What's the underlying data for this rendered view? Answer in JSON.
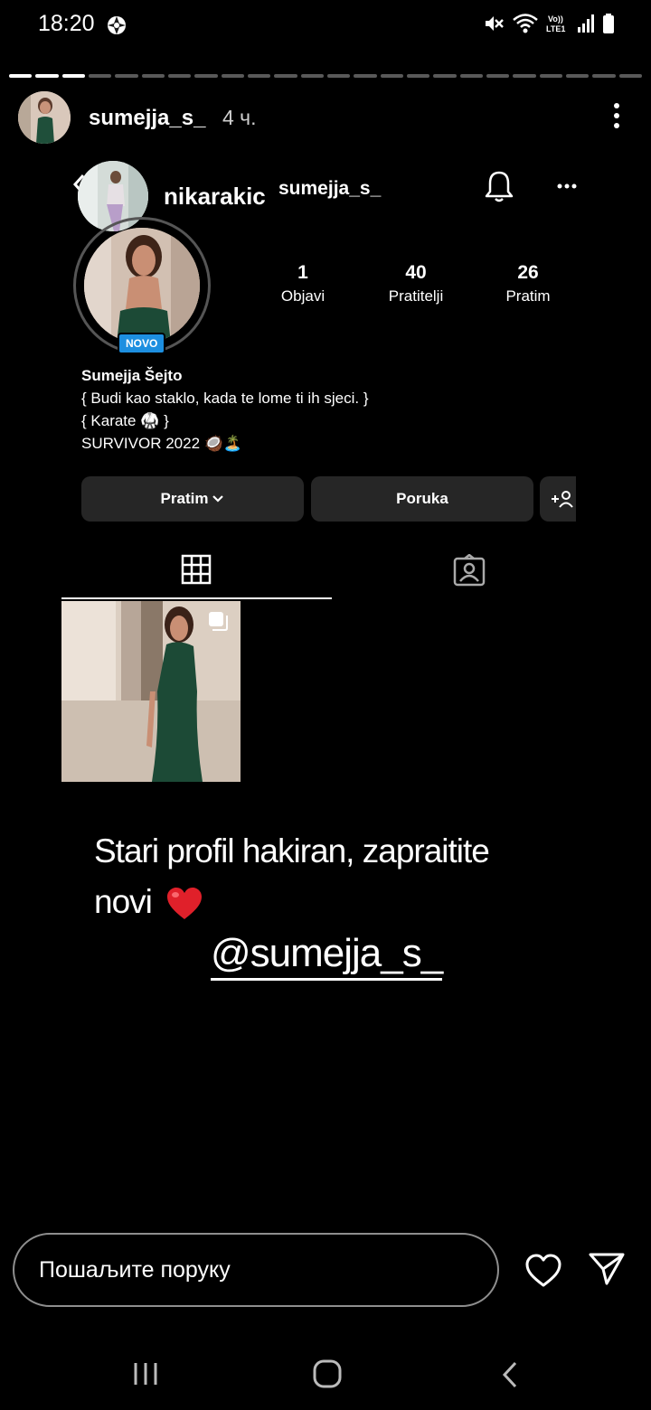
{
  "status_bar": {
    "time": "18:20",
    "left_icon": "aperture-icon",
    "right_icons": [
      "mute-icon",
      "wifi-icon",
      "volte-icon",
      "signal-icon",
      "battery-icon"
    ],
    "volte_label": "Vo))\nLTE1"
  },
  "story": {
    "progress_segments_total": 24,
    "progress_segments_done": 3,
    "username": "sumejja_s_",
    "time_ago": "4 ч.",
    "more_icon": "more-vertical-icon"
  },
  "embedded_profile": {
    "back_icon": "chevron-left-icon",
    "viewer_handle": "nikarakic",
    "profile_handle": "sumejja_s_",
    "bell_icon": "bell-icon",
    "more_icon": "more-horizontal-icon",
    "new_badge": "NOVO",
    "stats": [
      {
        "value": "1",
        "label": "Objavi"
      },
      {
        "value": "40",
        "label": "Pratitelji"
      },
      {
        "value": "26",
        "label": "Pratim"
      }
    ],
    "bio": {
      "name": "Sumejja Šejto",
      "line1": "{ Budi kao staklo, kada te lome ti ih sjeci. }",
      "line2": "{ Karate 🥋 }",
      "line3": "SURVIVOR 2022 🥥🏝️"
    },
    "buttons": {
      "follow": "Pratim",
      "message": "Poruka",
      "add_user": "+👤"
    },
    "tabs": [
      "grid-icon",
      "tagged-icon"
    ],
    "posts": 1
  },
  "story_text": {
    "line1": "Stari profil hakiran, zapraitite",
    "line2": "novi",
    "emoji": "heart-emoji",
    "mention": "@sumejja_s_"
  },
  "reply": {
    "placeholder": "Пошаљите поруку",
    "like_icon": "heart-icon",
    "send_icon": "send-icon"
  },
  "colors": {
    "background": "#000000",
    "button": "#262626",
    "badge": "#1d8fe0",
    "heart": "#e0202a"
  }
}
